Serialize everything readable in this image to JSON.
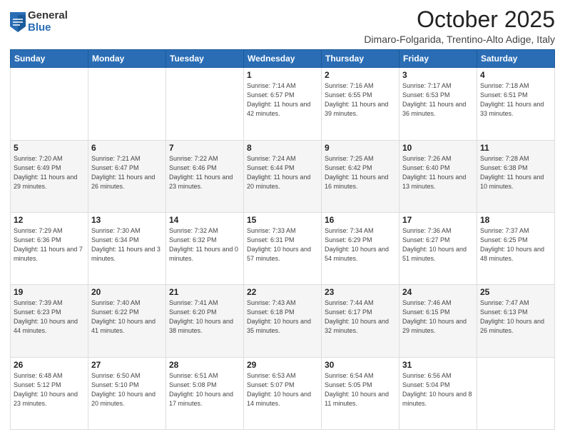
{
  "logo": {
    "general": "General",
    "blue": "Blue"
  },
  "header": {
    "month": "October 2025",
    "location": "Dimaro-Folgarida, Trentino-Alto Adige, Italy"
  },
  "days_of_week": [
    "Sunday",
    "Monday",
    "Tuesday",
    "Wednesday",
    "Thursday",
    "Friday",
    "Saturday"
  ],
  "weeks": [
    [
      {
        "day": "",
        "info": ""
      },
      {
        "day": "",
        "info": ""
      },
      {
        "day": "",
        "info": ""
      },
      {
        "day": "1",
        "info": "Sunrise: 7:14 AM\nSunset: 6:57 PM\nDaylight: 11 hours and 42 minutes."
      },
      {
        "day": "2",
        "info": "Sunrise: 7:16 AM\nSunset: 6:55 PM\nDaylight: 11 hours and 39 minutes."
      },
      {
        "day": "3",
        "info": "Sunrise: 7:17 AM\nSunset: 6:53 PM\nDaylight: 11 hours and 36 minutes."
      },
      {
        "day": "4",
        "info": "Sunrise: 7:18 AM\nSunset: 6:51 PM\nDaylight: 11 hours and 33 minutes."
      }
    ],
    [
      {
        "day": "5",
        "info": "Sunrise: 7:20 AM\nSunset: 6:49 PM\nDaylight: 11 hours and 29 minutes."
      },
      {
        "day": "6",
        "info": "Sunrise: 7:21 AM\nSunset: 6:47 PM\nDaylight: 11 hours and 26 minutes."
      },
      {
        "day": "7",
        "info": "Sunrise: 7:22 AM\nSunset: 6:46 PM\nDaylight: 11 hours and 23 minutes."
      },
      {
        "day": "8",
        "info": "Sunrise: 7:24 AM\nSunset: 6:44 PM\nDaylight: 11 hours and 20 minutes."
      },
      {
        "day": "9",
        "info": "Sunrise: 7:25 AM\nSunset: 6:42 PM\nDaylight: 11 hours and 16 minutes."
      },
      {
        "day": "10",
        "info": "Sunrise: 7:26 AM\nSunset: 6:40 PM\nDaylight: 11 hours and 13 minutes."
      },
      {
        "day": "11",
        "info": "Sunrise: 7:28 AM\nSunset: 6:38 PM\nDaylight: 11 hours and 10 minutes."
      }
    ],
    [
      {
        "day": "12",
        "info": "Sunrise: 7:29 AM\nSunset: 6:36 PM\nDaylight: 11 hours and 7 minutes."
      },
      {
        "day": "13",
        "info": "Sunrise: 7:30 AM\nSunset: 6:34 PM\nDaylight: 11 hours and 3 minutes."
      },
      {
        "day": "14",
        "info": "Sunrise: 7:32 AM\nSunset: 6:32 PM\nDaylight: 11 hours and 0 minutes."
      },
      {
        "day": "15",
        "info": "Sunrise: 7:33 AM\nSunset: 6:31 PM\nDaylight: 10 hours and 57 minutes."
      },
      {
        "day": "16",
        "info": "Sunrise: 7:34 AM\nSunset: 6:29 PM\nDaylight: 10 hours and 54 minutes."
      },
      {
        "day": "17",
        "info": "Sunrise: 7:36 AM\nSunset: 6:27 PM\nDaylight: 10 hours and 51 minutes."
      },
      {
        "day": "18",
        "info": "Sunrise: 7:37 AM\nSunset: 6:25 PM\nDaylight: 10 hours and 48 minutes."
      }
    ],
    [
      {
        "day": "19",
        "info": "Sunrise: 7:39 AM\nSunset: 6:23 PM\nDaylight: 10 hours and 44 minutes."
      },
      {
        "day": "20",
        "info": "Sunrise: 7:40 AM\nSunset: 6:22 PM\nDaylight: 10 hours and 41 minutes."
      },
      {
        "day": "21",
        "info": "Sunrise: 7:41 AM\nSunset: 6:20 PM\nDaylight: 10 hours and 38 minutes."
      },
      {
        "day": "22",
        "info": "Sunrise: 7:43 AM\nSunset: 6:18 PM\nDaylight: 10 hours and 35 minutes."
      },
      {
        "day": "23",
        "info": "Sunrise: 7:44 AM\nSunset: 6:17 PM\nDaylight: 10 hours and 32 minutes."
      },
      {
        "day": "24",
        "info": "Sunrise: 7:46 AM\nSunset: 6:15 PM\nDaylight: 10 hours and 29 minutes."
      },
      {
        "day": "25",
        "info": "Sunrise: 7:47 AM\nSunset: 6:13 PM\nDaylight: 10 hours and 26 minutes."
      }
    ],
    [
      {
        "day": "26",
        "info": "Sunrise: 6:48 AM\nSunset: 5:12 PM\nDaylight: 10 hours and 23 minutes."
      },
      {
        "day": "27",
        "info": "Sunrise: 6:50 AM\nSunset: 5:10 PM\nDaylight: 10 hours and 20 minutes."
      },
      {
        "day": "28",
        "info": "Sunrise: 6:51 AM\nSunset: 5:08 PM\nDaylight: 10 hours and 17 minutes."
      },
      {
        "day": "29",
        "info": "Sunrise: 6:53 AM\nSunset: 5:07 PM\nDaylight: 10 hours and 14 minutes."
      },
      {
        "day": "30",
        "info": "Sunrise: 6:54 AM\nSunset: 5:05 PM\nDaylight: 10 hours and 11 minutes."
      },
      {
        "day": "31",
        "info": "Sunrise: 6:56 AM\nSunset: 5:04 PM\nDaylight: 10 hours and 8 minutes."
      },
      {
        "day": "",
        "info": ""
      }
    ]
  ]
}
